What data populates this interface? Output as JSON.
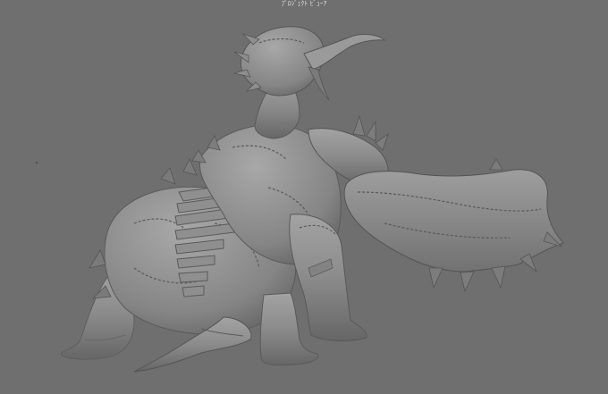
{
  "viewport": {
    "hud_label": "ﾌﾟﾛｼﾞｪｸﾄ ﾋﾞｭｰｱ",
    "background_color": "#6f6f6f",
    "model_color": "#8a8a8a"
  },
  "scene": {
    "object": "creature-model"
  }
}
